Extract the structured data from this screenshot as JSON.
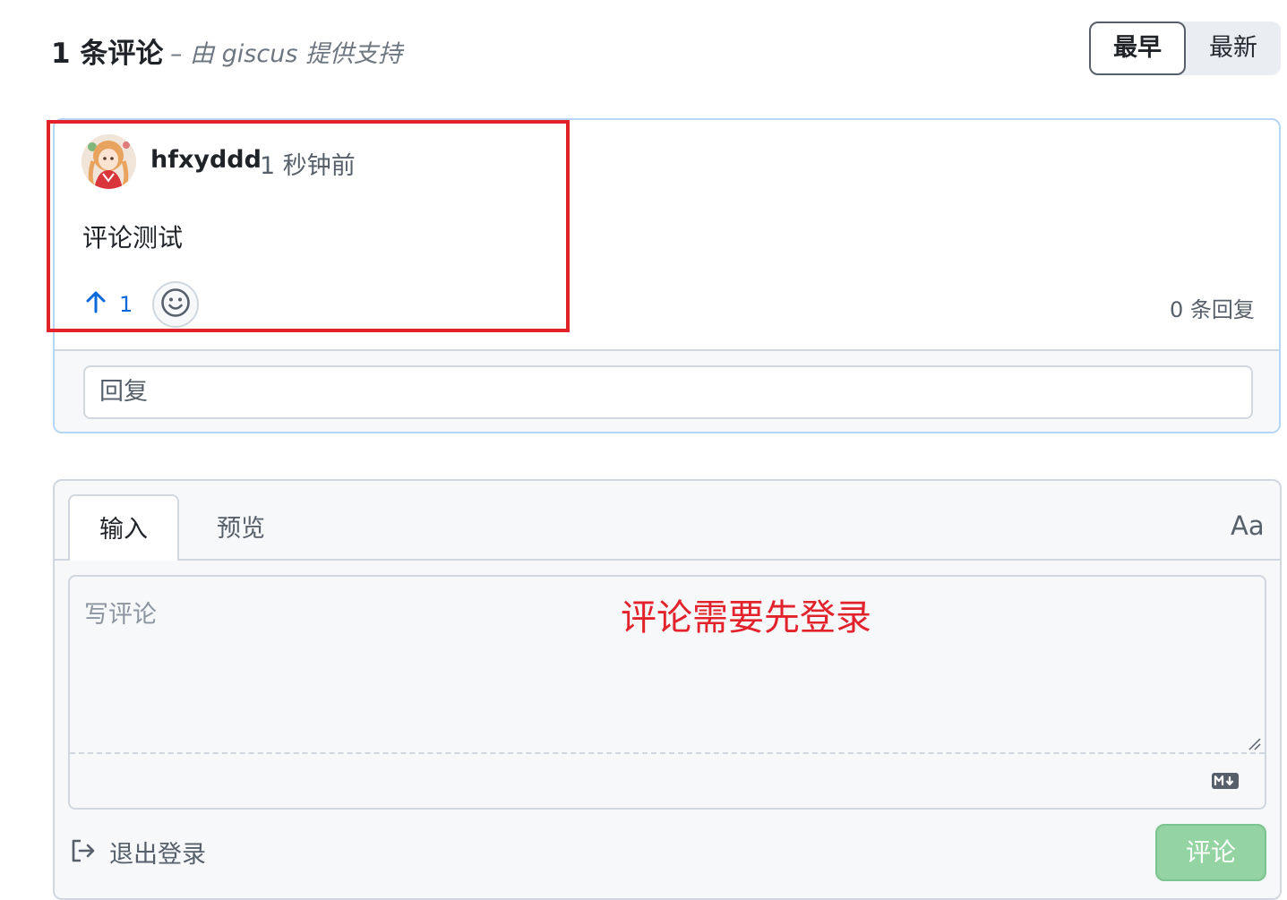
{
  "header": {
    "count_title": "1 条评论",
    "powered_by": "– 由 giscus 提供支持",
    "sort_oldest": "最早",
    "sort_newest": "最新"
  },
  "comment": {
    "author": "hfxyddd",
    "timestamp": "1 秒钟前",
    "body": "评论测试",
    "upvotes": "1",
    "reply_count": "0 条回复",
    "reply_placeholder": "回复"
  },
  "annotation": {
    "notice": "评论需要先登录",
    "color": "#e3232c"
  },
  "composer": {
    "tab_write": "输入",
    "tab_preview": "预览",
    "text_size": "Aa",
    "placeholder": "写评论",
    "signout": "退出登录",
    "submit": "评论"
  },
  "icons": {
    "upvote": "arrow-up-icon",
    "reaction": "smiley-icon",
    "markdown": "markdown-icon",
    "signout": "sign-out-icon"
  },
  "colors": {
    "accent_blue": "#0969da",
    "submit_green_disabled": "#94d3a2",
    "card_border": "#b6d6f7"
  }
}
